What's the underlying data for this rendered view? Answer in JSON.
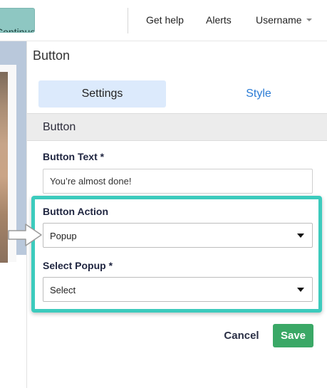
{
  "topbar": {
    "continue_label": "Continue",
    "help_label": "Get help",
    "alerts_label": "Alerts",
    "username_label": "Username"
  },
  "panel": {
    "title": "Button",
    "tabs": [
      {
        "label": "Settings",
        "active": true
      },
      {
        "label": "Style",
        "active": false
      }
    ],
    "section_title": "Button"
  },
  "form": {
    "button_text_label": "Button Text *",
    "button_text_value": "You’re almost done!",
    "button_action_label": "Button Action",
    "button_action_value": "Popup",
    "select_popup_label": "Select Popup *",
    "select_popup_value": "Select"
  },
  "actions": {
    "cancel_label": "Cancel",
    "save_label": "Save"
  },
  "colors": {
    "highlight": "#3ccbbd",
    "save_button": "#3aa866",
    "active_tab": "#dceafc",
    "link": "#2a7bd5",
    "continue_button": "#8ec7c2"
  }
}
